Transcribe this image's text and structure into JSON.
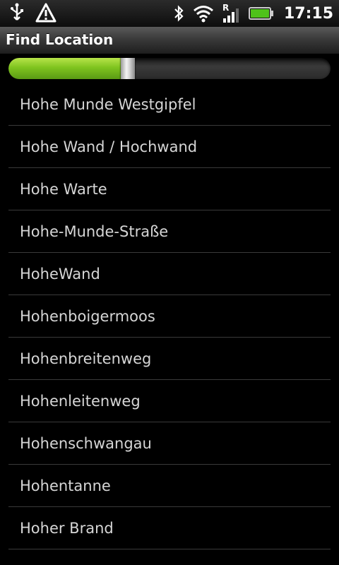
{
  "status_bar": {
    "time": "17:15",
    "icons": [
      "usb-icon",
      "warning-icon",
      "bluetooth-icon",
      "wifi-icon",
      "signal-roaming-icon",
      "battery-icon"
    ],
    "network_indicator": "R"
  },
  "header": {
    "title": "Find Location"
  },
  "progress": {
    "value_percent": 37,
    "fill_color": "#8fd023"
  },
  "list": {
    "items": [
      "Hohe Munde Westgipfel",
      "Hohe Wand / Hochwand",
      "Hohe Warte",
      "Hohe-Munde-Straße",
      "HoheWand",
      "Hohenboigermoos",
      "Hohenbreitenweg",
      "Hohenleitenweg",
      "Hohenschwangau",
      "Hohentanne",
      "Hoher Brand"
    ]
  }
}
